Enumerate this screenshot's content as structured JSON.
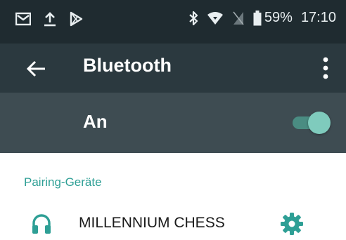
{
  "status_bar": {
    "battery_percent": "59%",
    "time": "17:10",
    "icons": [
      "mail-icon",
      "upload-icon",
      "play-store-icon",
      "bluetooth-icon",
      "wifi-icon",
      "no-sim-icon",
      "battery-icon"
    ]
  },
  "toolbar": {
    "title": "Bluetooth",
    "back_icon": "arrow-left-icon",
    "menu_icon": "more-vert-icon"
  },
  "master_switch": {
    "label": "An",
    "checked": true
  },
  "paired_section": {
    "header": "Pairing-Geräte",
    "devices": [
      {
        "name": "MILLENNIUM CHESS",
        "icon": "headset-icon",
        "settings_icon": "gear-icon"
      }
    ]
  },
  "colors": {
    "status_bar_bg": "#1f2b30",
    "toolbar_bg": "#2b393f",
    "switch_row_bg": "#3e4c52",
    "accent": "#2e9f95",
    "toggle_thumb": "#7fcbbd",
    "toggle_track": "#4a8c82"
  }
}
